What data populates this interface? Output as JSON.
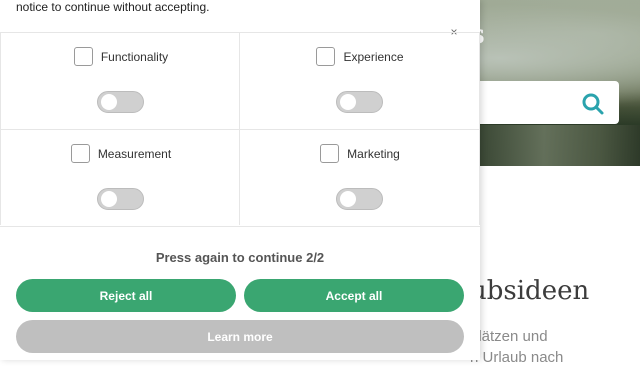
{
  "background": {
    "logo_text": "s",
    "search_icon": "search-icon",
    "heading": "ubsideen",
    "body_line1": "plätzen und",
    "body_line2": "n Urlaub nach"
  },
  "consent": {
    "notice": "notice to continue without accepting.",
    "close_label": "×",
    "categories": [
      {
        "label": "Functionality",
        "checked": false,
        "enabled": false
      },
      {
        "label": "Experience",
        "checked": false,
        "enabled": false
      },
      {
        "label": "Measurement",
        "checked": false,
        "enabled": false
      },
      {
        "label": "Marketing",
        "checked": false,
        "enabled": false
      }
    ],
    "press_again": "Press again to continue 2/2",
    "reject_label": "Reject all",
    "accept_label": "Accept all",
    "learn_label": "Learn more"
  },
  "colors": {
    "primary_green": "#3aa671",
    "learn_more_gray": "#bfbfbf",
    "search_icon_teal": "#2aa3ad"
  }
}
